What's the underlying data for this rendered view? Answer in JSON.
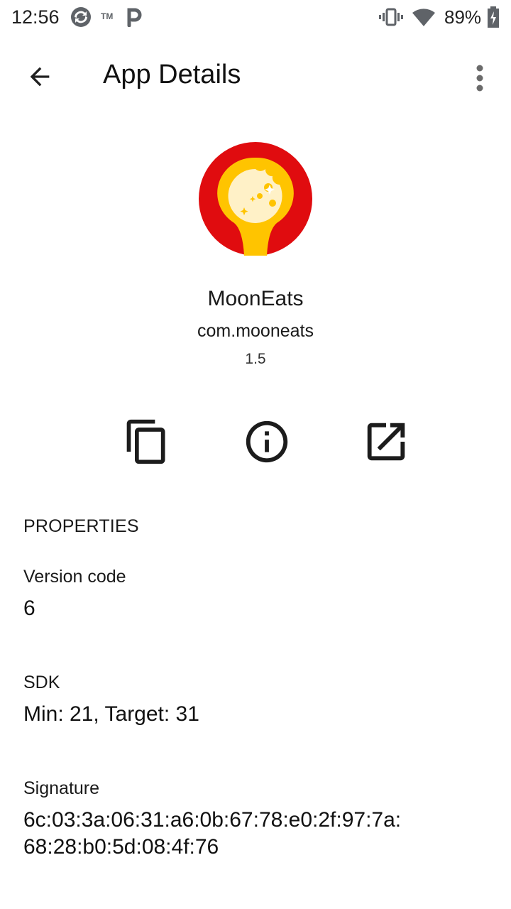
{
  "status_bar": {
    "time": "12:56",
    "battery_text": "89%",
    "icons": [
      "sync-badge-icon",
      "tm-icon",
      "parking-p-icon",
      "vibrate-icon",
      "wifi-icon",
      "battery-charging-icon"
    ],
    "tm_text": "TM"
  },
  "app_bar": {
    "title": "App Details",
    "back_icon": "arrow-back-icon",
    "overflow_icon": "more-vert-icon"
  },
  "app": {
    "name": "MoonEats",
    "package": "com.mooneats",
    "version": "1.5",
    "icon": "moon-spoon-logo",
    "colors": {
      "ring": "#e00c0f",
      "moon": "#ffc400",
      "crater": "#fff1c7"
    }
  },
  "actions": [
    {
      "icon": "copy-icon"
    },
    {
      "icon": "info-icon"
    },
    {
      "icon": "open-external-icon"
    }
  ],
  "properties": {
    "header": "PROPERTIES",
    "items": [
      {
        "label": "Version code",
        "value": "6"
      },
      {
        "label": "SDK",
        "value": "Min: 21, Target: 31"
      },
      {
        "label": "Signature",
        "value": "6c:03:3a:06:31:a6:0b:67:78:e0:2f:97:7a:",
        "value2": "68:28:b0:5d:08:4f:76"
      }
    ]
  }
}
